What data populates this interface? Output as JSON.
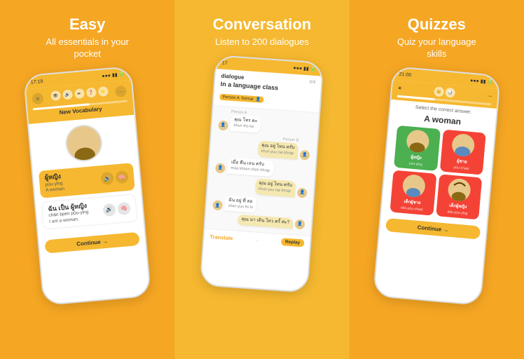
{
  "panels": [
    {
      "id": "easy",
      "title": "Easy",
      "subtitle": "All essentials in your\npocket",
      "bgColor": "#F5A623"
    },
    {
      "id": "conversation",
      "title": "Conversation",
      "subtitle": "Listen to 200 dialogues",
      "bgColor": "#F5B830"
    },
    {
      "id": "quizzes",
      "title": "Quizzes",
      "subtitle": "Quiz your language\nskills",
      "bgColor": "#F5A623"
    }
  ],
  "phone_left": {
    "status_time": "17:19",
    "section_title": "New Vocabulary",
    "vocab_items": [
      {
        "thai": "ผู้หญิง",
        "romanized": "pûu-yǐng",
        "english": "A woman"
      },
      {
        "thai": "ฉัน เป็น ผู้หญิง",
        "romanized": "chǎn bpen pûu-yǐng",
        "english": "I am a woman."
      }
    ],
    "continue_label": "Continue →"
  },
  "phone_mid": {
    "status_time": "17",
    "dialogue_title": "logue",
    "page_indicator": "3/4",
    "dialogue_heading": "In a language class",
    "formal_label": "formal",
    "messages": [
      {
        "side": "left",
        "text": "คุณ โทร คะ\nkhun tho ka"
      },
      {
        "side": "right",
        "text": "คุณ อยู่ ไหน ครับ\nkhun yuu nai khrap"
      },
      {
        "side": "left",
        "text": "เมื่อ คืน เจน ครับ\nmüa khüen chen khrap"
      },
      {
        "side": "right",
        "text": "คุณ อยู่ ไหน ครับ\nkhun yuu nai khrap"
      },
      {
        "side": "left",
        "text": "ฉัน อยู่ ที่ ลอ\nchan yuu thi lo"
      },
      {
        "side": "right",
        "text": "คุณ มา เดิน ไหว ครั้ ค่ะ?\nkhun ma dœn wai khrang kha?"
      }
    ],
    "translate_label": "Translate",
    "replay_label": "Replay"
  },
  "phone_right": {
    "status_time": "21:00",
    "instruction": "Select the correct answer.",
    "question_word": "A woman",
    "options": [
      {
        "thai": "ผู้หญิง",
        "roman": "pûu-yǐng",
        "state": "correct"
      },
      {
        "thai": "ผู้ชาย",
        "roman": "pûu-chaai",
        "state": "wrong"
      },
      {
        "thai": "เด็กผู้ชาย",
        "roman": "dèk-pûu-chaai",
        "state": "wrong"
      },
      {
        "thai": "เด็กผู้หญิง",
        "roman": "dèk-pûu-yǐng",
        "state": "wrong"
      }
    ],
    "continue_label": "Continue →"
  }
}
